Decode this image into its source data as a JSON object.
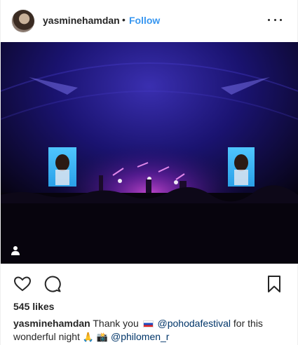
{
  "header": {
    "username": "yasminehamdan",
    "separator": "•",
    "follow_label": "Follow"
  },
  "photo": {
    "icons": [
      "user-tag-icon"
    ]
  },
  "actions": {
    "icons": [
      "like-icon",
      "comment-icon",
      "bookmark-icon"
    ]
  },
  "likes_text": "545 likes",
  "caption": {
    "username": "yasminehamdan",
    "text_1": "Thank you",
    "flag_icon": "slovakia-flag-icon",
    "mention_1": "@pohodafestival",
    "text_2": "for this wonderful night",
    "emoji_pray": "🙏",
    "emoji_camera": "📸",
    "mention_2": "@philomen_r"
  },
  "colors": {
    "accent": "#3897f0",
    "text": "#262626",
    "mention": "#003569"
  }
}
